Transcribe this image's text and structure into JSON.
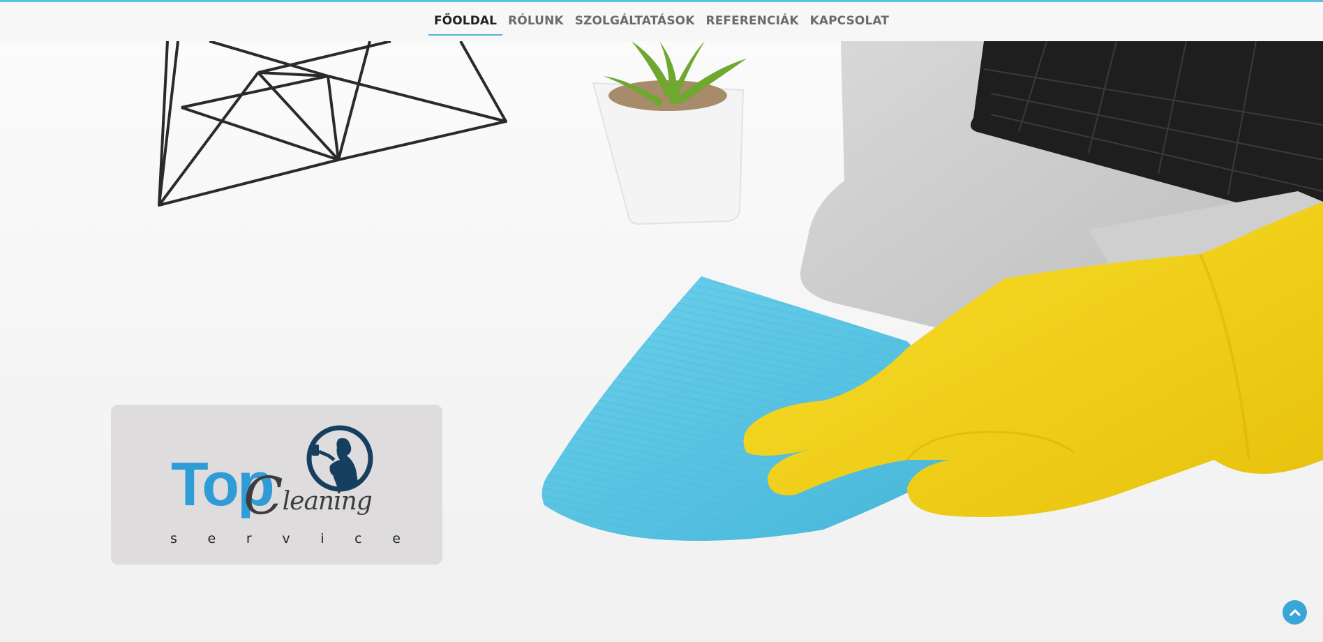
{
  "nav": {
    "items": [
      {
        "label": "FŐOLDAL",
        "active": true
      },
      {
        "label": "RÓLUNK",
        "active": false
      },
      {
        "label": "SZOLGÁLTATÁSOK",
        "active": false
      },
      {
        "label": "REFERENCIÁK",
        "active": false
      },
      {
        "label": "KAPCSOLAT",
        "active": false
      }
    ]
  },
  "logo": {
    "top_text": "Top",
    "cleaning_first": "C",
    "cleaning_rest": "leaning",
    "service_letters": [
      "s",
      "e",
      "r",
      "v",
      "i",
      "c",
      "e"
    ]
  },
  "back_to_top": {
    "icon": "chevron-up-icon"
  },
  "colors": {
    "accent": "#5cc3df",
    "logo_blue": "#2f9bd7",
    "emblem_navy": "#163f5f",
    "cloth": "#5ec8e6",
    "glove": "#f3d41e"
  }
}
